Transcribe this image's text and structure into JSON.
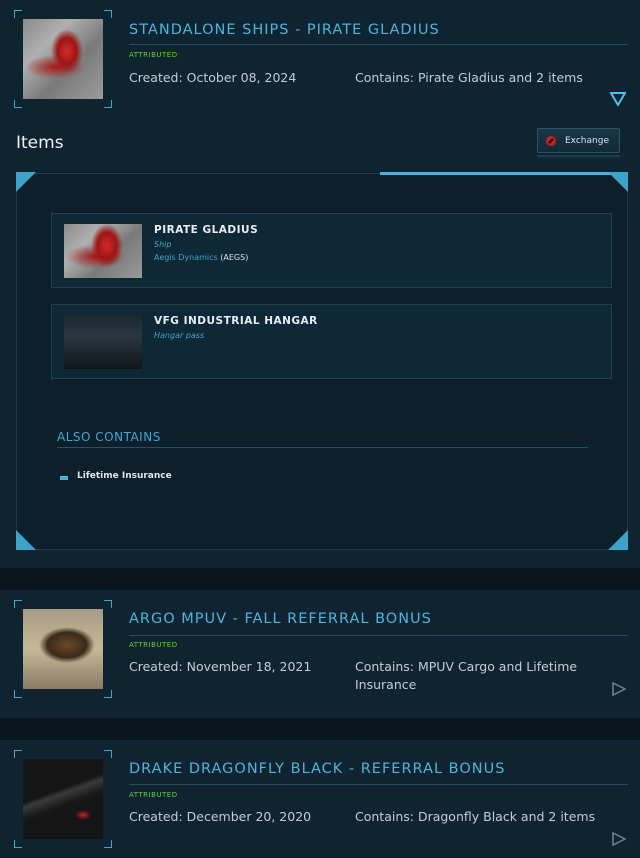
{
  "pledges": [
    {
      "title": "STANDALONE SHIPS - PIRATE GLADIUS",
      "status": "ATTRIBUTED",
      "created": "Created: October 08, 2024",
      "contains": "Contains: Pirate Gladius and 2 items",
      "thumbnail": "pirate-gladius-image",
      "expand_icon": "chevron-down-icon",
      "expanded": true
    },
    {
      "title": "ARGO MPUV - FALL REFERRAL BONUS",
      "status": "ATTRIBUTED",
      "created": "Created: November 18, 2021",
      "contains_line1": "Contains: MPUV Cargo and Lifetime",
      "contains_line2": "Insurance",
      "thumbnail": "argo-mpuv-image",
      "expand_icon": "chevron-right-icon",
      "expanded": false
    },
    {
      "title": "DRAKE DRAGONFLY BLACK - REFERRAL BONUS",
      "status": "ATTRIBUTED",
      "created": "Created: December 20, 2020",
      "contains": "Contains: Dragonfly Black and 2 items",
      "thumbnail": "dragonfly-black-image",
      "expand_icon": "chevron-right-icon",
      "expanded": false
    }
  ],
  "items_section": {
    "heading": "Items",
    "exchange_label": "Exchange",
    "exchange_icon": "no-entry-icon",
    "items": [
      {
        "name": "PIRATE GLADIUS",
        "type": "Ship",
        "manufacturer": "Aegis Dynamics",
        "manufacturer_code": "(AEGS)"
      },
      {
        "name": "VFG INDUSTRIAL HANGAR",
        "type": "Hangar pass"
      }
    ],
    "also_contains_heading": "ALSO CONTAINS",
    "also_contains": [
      "Lifetime Insurance"
    ]
  },
  "colors": {
    "accent": "#4fb5dc",
    "attributed": "#5ed63a",
    "background": "#0a1a24",
    "exchange_icon": "#c42222"
  }
}
